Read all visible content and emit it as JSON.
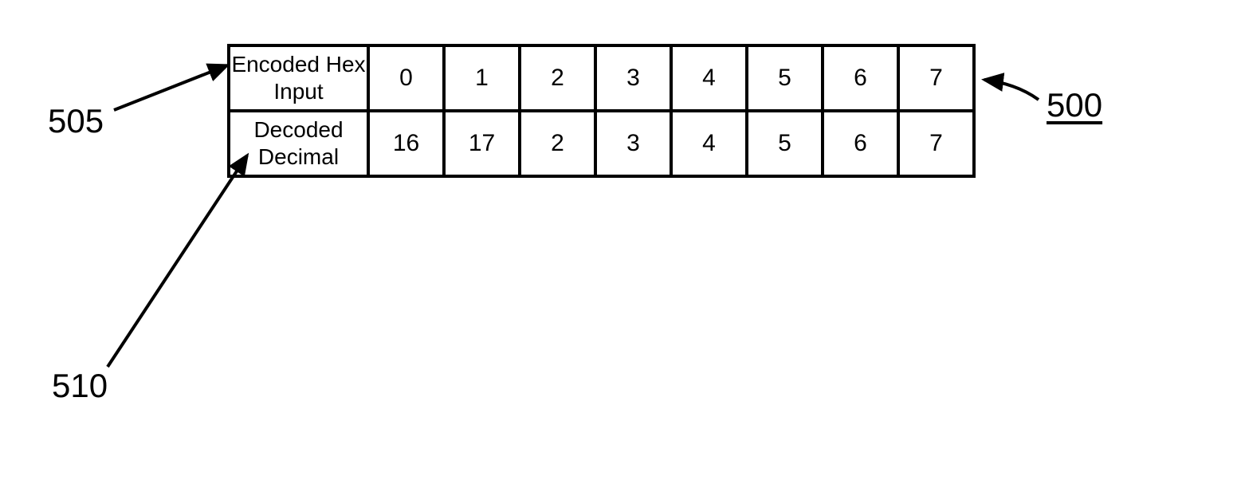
{
  "chart_data": {
    "type": "table",
    "rows": [
      {
        "label": "Encoded Hex Input",
        "values": [
          "0",
          "1",
          "2",
          "3",
          "4",
          "5",
          "6",
          "7"
        ]
      },
      {
        "label": "Decoded Decimal",
        "values": [
          "16",
          "17",
          "2",
          "3",
          "4",
          "5",
          "6",
          "7"
        ]
      }
    ]
  },
  "annotations": {
    "ref_500": "500",
    "ref_505": "505",
    "ref_510": "510"
  }
}
